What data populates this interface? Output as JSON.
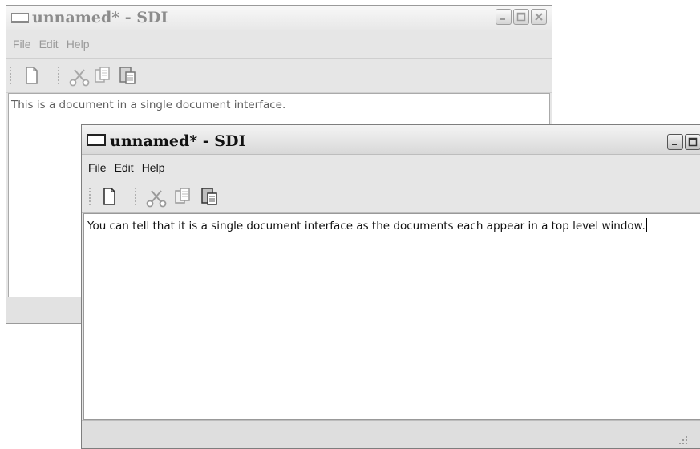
{
  "windows": {
    "back": {
      "title": "unnamed* - SDI",
      "menu": [
        "File",
        "Edit",
        "Help"
      ],
      "document_text": "This is a document in a single document interface."
    },
    "front": {
      "title": "unnamed* - SDI",
      "menu": [
        "File",
        "Edit",
        "Help"
      ],
      "document_text": "You can tell that it is a single document interface as the documents each appear in a top level window."
    }
  },
  "toolbar_icons": [
    "new-document-icon",
    "cut-scissors-icon",
    "copy-icon",
    "paste-icon"
  ],
  "title_buttons": [
    "minimize-icon",
    "maximize-icon",
    "close-icon"
  ]
}
